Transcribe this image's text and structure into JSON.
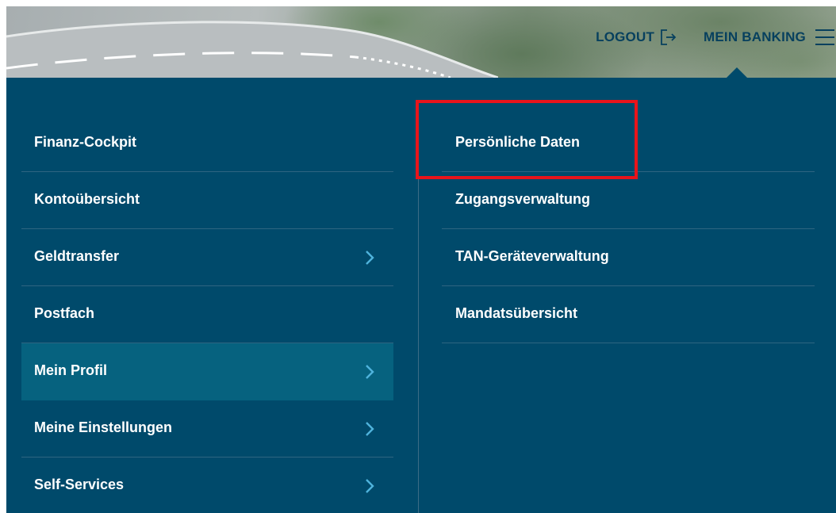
{
  "header": {
    "logout_label": "LOGOUT",
    "banking_label": "MEIN BANKING"
  },
  "menu": {
    "left": [
      {
        "label": "Finanz-Cockpit",
        "has_submenu": false,
        "active": false
      },
      {
        "label": "Kontoübersicht",
        "has_submenu": false,
        "active": false
      },
      {
        "label": "Geldtransfer",
        "has_submenu": true,
        "active": false
      },
      {
        "label": "Postfach",
        "has_submenu": false,
        "active": false
      },
      {
        "label": "Mein Profil",
        "has_submenu": true,
        "active": true
      },
      {
        "label": "Meine Einstellungen",
        "has_submenu": true,
        "active": false
      },
      {
        "label": "Self-Services",
        "has_submenu": true,
        "active": false
      }
    ],
    "right": [
      {
        "label": "Persönliche Daten",
        "highlighted": true
      },
      {
        "label": "Zugangsverwaltung"
      },
      {
        "label": "TAN-Geräteverwaltung"
      },
      {
        "label": "Mandatsübersicht"
      }
    ]
  },
  "colors": {
    "panel_bg": "#004a6b",
    "active_item_bg": "#06627f",
    "header_text": "#07405e",
    "highlight_border": "#e8141b",
    "chevron": "#4fb3dc"
  },
  "icons": {
    "logout": "logout-icon",
    "menu": "hamburger-menu-icon",
    "submenu": "chevron-right-icon"
  }
}
